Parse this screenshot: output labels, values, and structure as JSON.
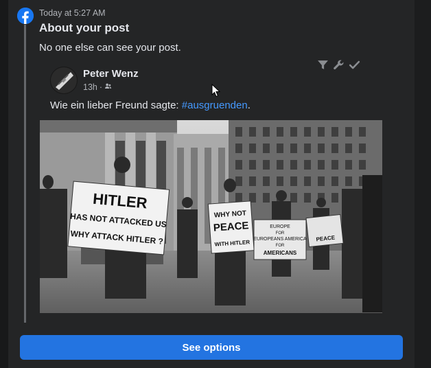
{
  "notification": {
    "app_icon": "facebook-icon",
    "timestamp": "Today at 5:27 AM",
    "title": "About your post",
    "message": "No one else can see your post."
  },
  "post": {
    "author": "Peter Wenz",
    "time": "13h",
    "separator": "·",
    "audience_icon": "friends-icon",
    "text_prefix": "Wie ein lieber Freund sagte: ",
    "hashtag": "#ausgruenden",
    "text_suffix": ".",
    "photo": {
      "description": "historical black-and-white street protest",
      "signs": [
        "HITLER",
        "HAS NOT ATTACKED US",
        "WHY ATTACK HITLER ?",
        "WHY NOT",
        "PEACE",
        "WITH HITLER",
        "EUROPE",
        "FOR",
        "EUROPEANS AMERICA",
        "FOR",
        "AMERICANS",
        "PEACE"
      ]
    }
  },
  "toolbar": {
    "icons": [
      "filter-icon",
      "wrench-icon",
      "checkmark-icon"
    ]
  },
  "actions": {
    "see_options_label": "See options"
  },
  "colors": {
    "background": "#242526",
    "accent": "#2374e1",
    "link": "#4599ff",
    "thread_line": "#65676b"
  }
}
